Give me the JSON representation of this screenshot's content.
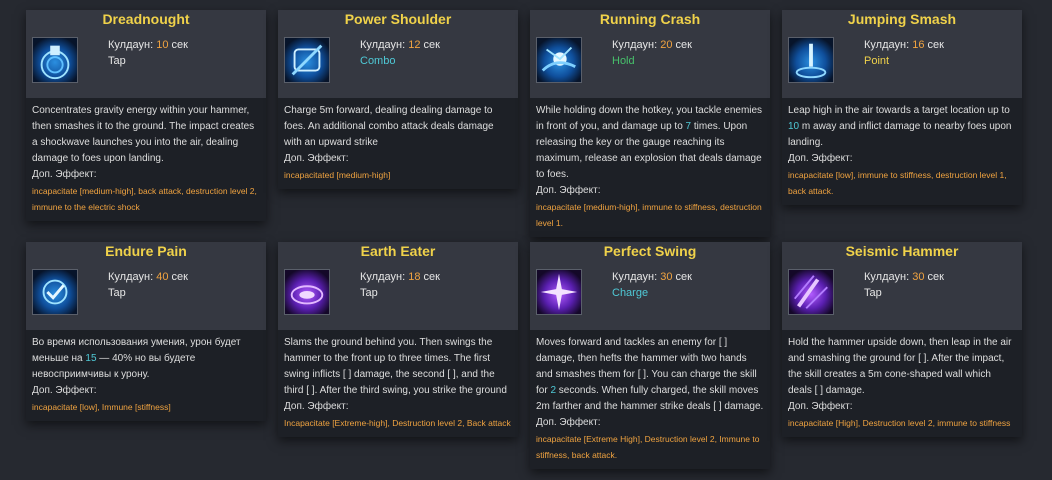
{
  "colors": {
    "title": "#f0d24a",
    "number": "#f0a340",
    "effects": "#f0a340",
    "highlight": "#4fc9d6",
    "type_combo": "#4fc9d6",
    "type_hold": "#47c06b",
    "type_point": "#f0d24a",
    "type_charge": "#4fc9d6",
    "type_tap": "#e6e6e6"
  },
  "labels": {
    "cooldown": "Кулдаун:",
    "seconds": "сек",
    "extra_effect": "Доп. Эффект:"
  },
  "skills": [
    {
      "name": "Dreadnought",
      "icon": "hammer-shockwave-icon",
      "cooldown": "10",
      "type": "Tap",
      "desc": [
        "Concentrates gravity energy within your hammer, then smashes it to the ground. The impact creates a shockwave launches you into the air, dealing damage to foes upon landing."
      ],
      "effects": "incapacitate [medium-high], back attack, destruction level 2, immune to the electric shock"
    },
    {
      "name": "Power Shoulder",
      "icon": "shoulder-charge-icon",
      "cooldown": "12",
      "type": "Combo",
      "desc": [
        "Charge 5m forward, dealing dealing damage to foes. An additional combo attack deals damage with an upward strike"
      ],
      "effects": "incapacitated [medium-high]"
    },
    {
      "name": "Running Crash",
      "icon": "running-crash-icon",
      "cooldown": "20",
      "type": "Hold",
      "desc": [
        "While holding down the hotkey, you tackle enemies in front of you, and damage up to ",
        "7",
        " times. Upon releasing the key or the gauge reaching its maximum, release an explosion that deals damage to foes."
      ],
      "effects": "incapacitate [medium-high], immune to stiffness, destruction level 1."
    },
    {
      "name": "Jumping Smash",
      "icon": "jumping-smash-icon",
      "cooldown": "16",
      "type": "Point",
      "desc": [
        "Leap high in the air towards a target location up to ",
        "10",
        " m away and inflict damage to nearby foes upon landing."
      ],
      "effects": "incapacitate [low], immune to stiffness, destruction level 1, back attack."
    },
    {
      "name": "Endure Pain",
      "icon": "endure-pain-icon",
      "cooldown": "40",
      "type": "Tap",
      "desc": [
        "Во время использования умения, урон будет меньше на ",
        "15",
        " — 40% но вы будете невосприимчивы к урону."
      ],
      "effects": "incapacitate [low], Immune [stiffness]"
    },
    {
      "name": "Earth Eater",
      "icon": "earth-eater-icon",
      "cooldown": "18",
      "type": "Tap",
      "desc": [
        "Slams the ground behind you. Then swings the hammer to the front up to three times. The first swing inflicts [ ] damage, the second [ ], and the third [ ]. After the third swing, you strike the ground"
      ],
      "effects": "Incapacitate [Extreme-high], Destruction level 2, Back attack"
    },
    {
      "name": "Perfect Swing",
      "icon": "perfect-swing-icon",
      "cooldown": "30",
      "type": "Charge",
      "desc": [
        "Moves forward and tackles an enemy for [ ] damage, then hefts the hammer with two hands and smashes them for [ ]. You can charge the skill for ",
        "2",
        " seconds. When fully charged, the skill moves 2m farther and the hammer strike deals [ ] damage."
      ],
      "effects": "incapacitate [Extreme High], Destruction level 2, Immune to stiffness, back attack."
    },
    {
      "name": "Seismic Hammer",
      "icon": "seismic-hammer-icon",
      "cooldown": "30",
      "type": "Tap",
      "desc": [
        "Hold the hammer upside down, then leap in the air and smashing the ground for [ ]. After the impact, the skill creates a 5m cone-shaped wall which deals [ ] damage."
      ],
      "effects": "incapacitate [High], Destruction level 2, immune to stiffness"
    }
  ]
}
